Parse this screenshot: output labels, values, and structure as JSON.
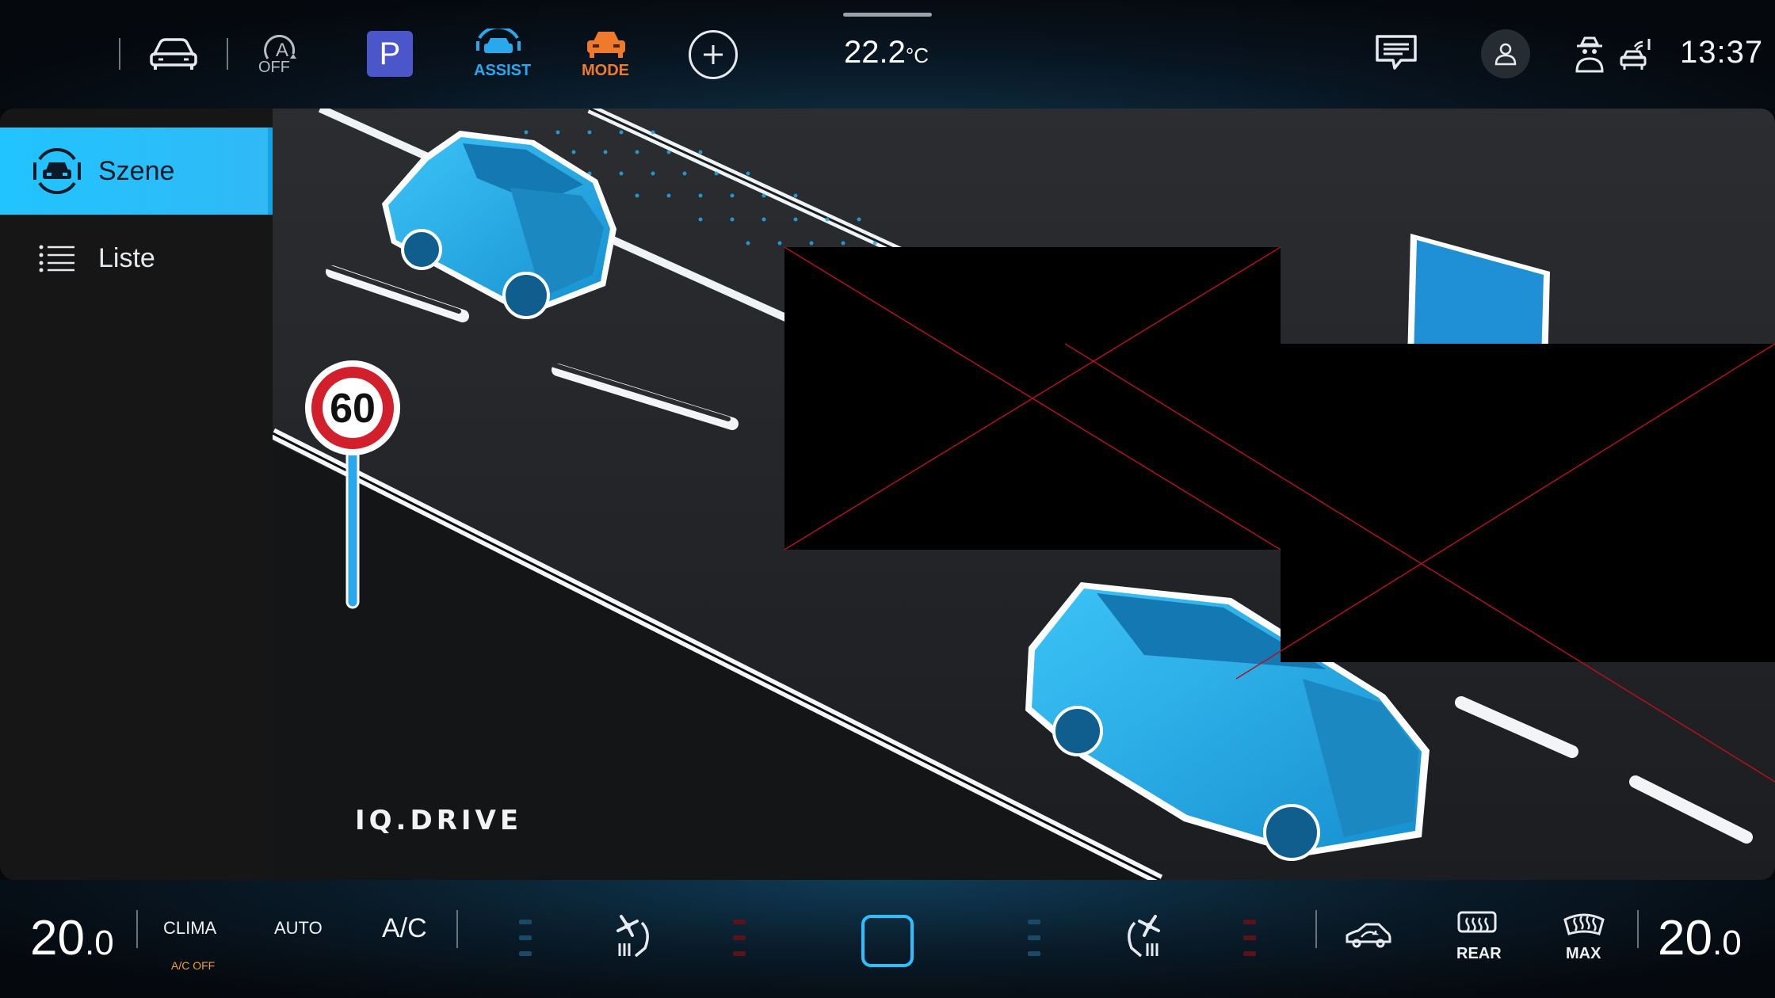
{
  "topbar": {
    "assist_label": "ASSIST",
    "mode_label": "MODE",
    "autohold_label": "OFF",
    "park_label": "P",
    "outside_temp": "22.2",
    "outside_temp_unit": "°C",
    "clock": "13:37",
    "colors": {
      "accent": "#22b6f2",
      "mode": "#f07a2c",
      "park": "#4a56c9"
    }
  },
  "sidebar": {
    "items": [
      {
        "label": "Szene",
        "icon": "car-sensors-icon",
        "active": true
      },
      {
        "label": "Liste",
        "icon": "list-icon",
        "active": false
      }
    ]
  },
  "scene": {
    "brand": "IQ.DRIVE",
    "speed_sign": "60"
  },
  "climate": {
    "left_temp_int": "20",
    "left_temp_dec": ".0",
    "right_temp_int": "20",
    "right_temp_dec": ".0",
    "clima_label": "CLIMA",
    "clima_sub": "A/C OFF",
    "auto_label": "AUTO",
    "ac_label": "A/C",
    "rear_label": "REAR",
    "max_label": "MAX"
  }
}
